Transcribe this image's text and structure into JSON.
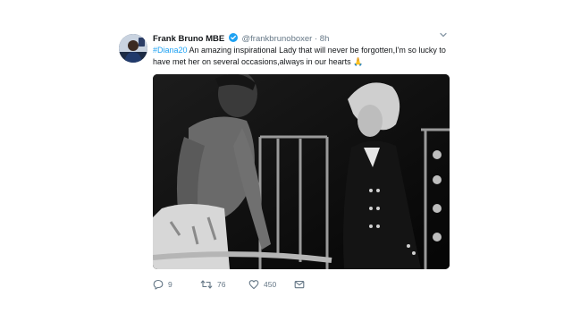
{
  "tweet": {
    "display_name": "Frank Bruno MBE",
    "handle": "@frankbrunoboxer",
    "separator": "·",
    "time": "8h",
    "hashtag": "#Diana20",
    "text": " An amazing inspirational Lady that will never be forgotten,I'm so lucky to have met her on several occasions,always in our hearts",
    "emoji": "🙏"
  },
  "actions": {
    "reply_count": "9",
    "retweet_count": "76",
    "like_count": "450"
  },
  "colors": {
    "link": "#1da1f2",
    "secondary_text": "#657786",
    "primary_text": "#14171a"
  },
  "icons": {
    "verified": "verified-badge-icon",
    "caret": "chevron-down-icon",
    "reply": "reply-icon",
    "retweet": "retweet-icon",
    "like": "heart-icon",
    "message": "envelope-icon"
  }
}
